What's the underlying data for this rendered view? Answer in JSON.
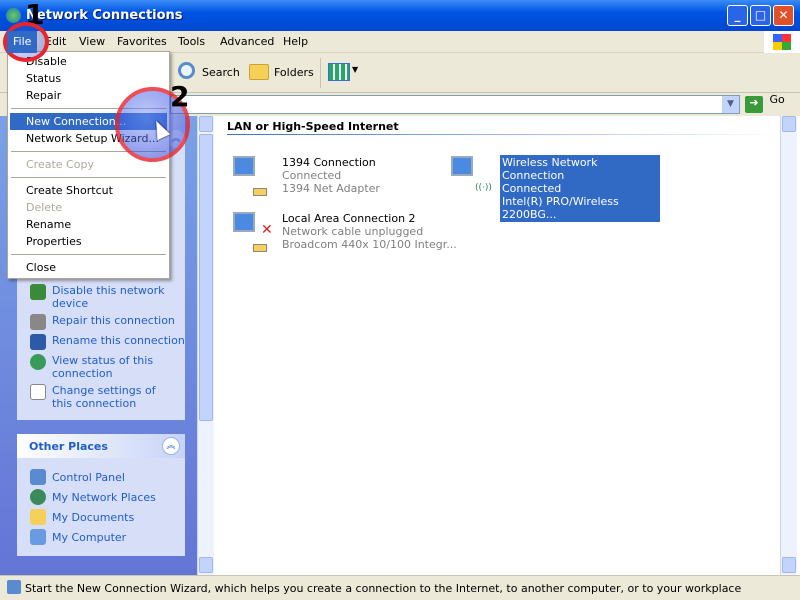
{
  "window": {
    "title": "Network Connections"
  },
  "menubar": [
    "File",
    "Edit",
    "View",
    "Favorites",
    "Tools",
    "Advanced",
    "Help"
  ],
  "toolbar": {
    "search": "Search",
    "folders": "Folders"
  },
  "address": {
    "go": "Go"
  },
  "file_menu": [
    {
      "label": "Disable",
      "state": "normal"
    },
    {
      "label": "Status",
      "state": "normal"
    },
    {
      "label": "Repair",
      "state": "normal"
    },
    {
      "label": "New Connection...",
      "state": "selected"
    },
    {
      "label": "Network Setup Wizard...",
      "state": "normal"
    },
    {
      "label": "Create Copy",
      "state": "disabled"
    },
    {
      "label": "Create Shortcut",
      "state": "normal"
    },
    {
      "label": "Delete",
      "state": "disabled"
    },
    {
      "label": "Rename",
      "state": "normal"
    },
    {
      "label": "Properties",
      "state": "normal"
    },
    {
      "label": "Close",
      "state": "normal"
    }
  ],
  "tasks": [
    "Disable this network device",
    "Repair this connection",
    "Rename this connection",
    "View status of this connection",
    "Change settings of this connection"
  ],
  "other_places": {
    "title": "Other Places",
    "links": [
      "Control Panel",
      "My Network Places",
      "My Documents",
      "My Computer"
    ]
  },
  "content": {
    "group": "LAN or High-Speed Internet",
    "items": [
      {
        "name": "1394 Connection",
        "status": "Connected",
        "device": "1394 Net Adapter"
      },
      {
        "name": "Wireless Network Connection",
        "status": "Connected",
        "device": "Intel(R) PRO/Wireless 2200BG..."
      },
      {
        "name": "Local Area Connection 2",
        "status": "Network cable unplugged",
        "device": "Broadcom 440x 10/100 Integr..."
      }
    ]
  },
  "annotations": [
    "1",
    "2"
  ],
  "status_bar": "Start the New Connection Wizard, which helps you create a connection to the Internet, to another computer, or to your workplace"
}
